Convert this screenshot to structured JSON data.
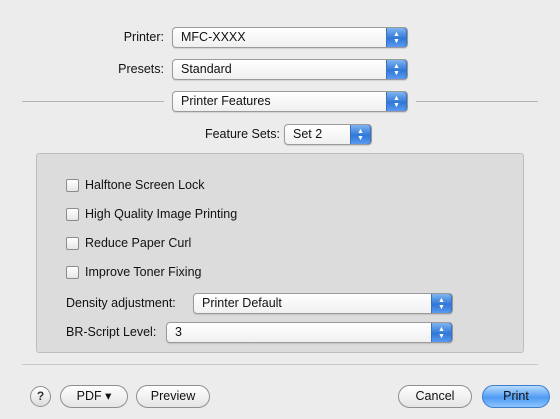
{
  "printer": {
    "label": "Printer:",
    "value": "MFC-XXXX"
  },
  "presets": {
    "label": "Presets:",
    "value": "Standard"
  },
  "pane": {
    "value": "Printer Features"
  },
  "feature_sets": {
    "label": "Feature Sets:",
    "value": "Set 2"
  },
  "options": [
    {
      "label": "Halftone Screen Lock",
      "checked": false
    },
    {
      "label": "High Quality Image Printing",
      "checked": false
    },
    {
      "label": "Reduce Paper Curl",
      "checked": false
    },
    {
      "label": "Improve Toner Fixing",
      "checked": false
    }
  ],
  "density": {
    "label": "Density adjustment:",
    "value": "Printer Default"
  },
  "br_script": {
    "label": "BR-Script Level:",
    "value": "3"
  },
  "buttons": {
    "help": "?",
    "pdf": "PDF ▾",
    "preview": "Preview",
    "cancel": "Cancel",
    "print": "Print"
  }
}
